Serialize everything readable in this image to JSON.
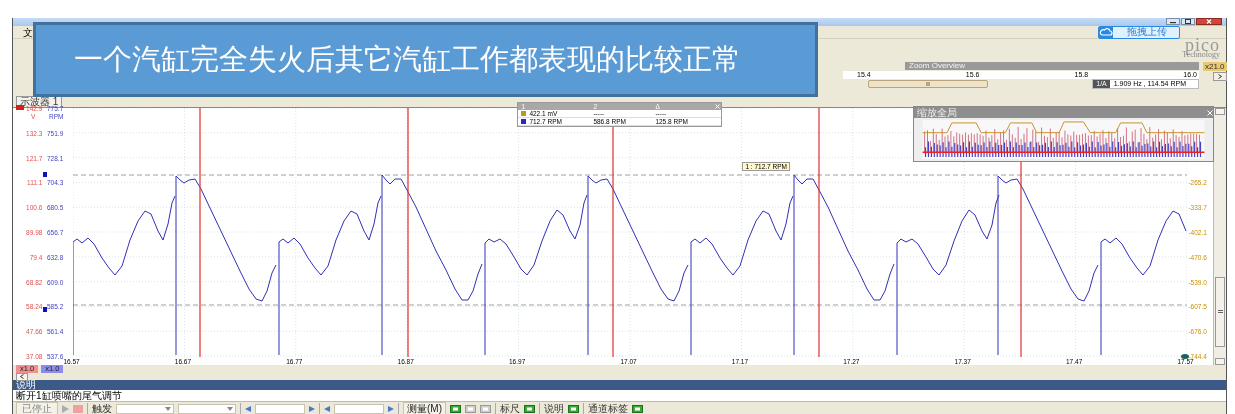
{
  "banner": {
    "text": "一个汽缸完全失火后其它汽缸工作都表现的比较正常"
  },
  "menu": {
    "items": [
      "文"
    ]
  },
  "upload_button": {
    "label": "拖拽上传"
  },
  "logo": {
    "text": "pico",
    "subtitle": "Technology"
  },
  "zoom_overview": {
    "title": "Zoom Overview",
    "ticks": [
      "15.4",
      "15.6",
      "15.8",
      "16.0"
    ],
    "readout_channel": "1/A",
    "readout": "1.909 Hz , 114.54 RPM",
    "zoom_badge": "x21.0"
  },
  "scope": {
    "tab": "示波器 1",
    "left_axis": {
      "unit": "V",
      "ticks": [
        "142.9",
        "132.3",
        "121.7",
        "111.1",
        "100.6",
        "89.98",
        "79.4",
        "68.82",
        "58.24",
        "47.66",
        "37.08"
      ]
    },
    "rpm_axis": {
      "unit": "RPM",
      "ticks": [
        "775.7",
        "751.9",
        "728.1",
        "704.3",
        "680.5",
        "656.7",
        "632.8",
        "609.0",
        "585.2",
        "561.4",
        "537.6"
      ]
    },
    "right_axis": {
      "ticks": [
        "-265.2",
        "-333.7",
        "-402.1",
        "-470.6",
        "-539.0",
        "-607.5",
        "-676.0",
        "-744.4"
      ]
    },
    "x_ticks": [
      "16.57",
      "16.67",
      "16.77",
      "16.87",
      "16.97",
      "17.07",
      "17.17",
      "17.27",
      "17.37",
      "17.47",
      "17.57"
    ],
    "cursor_table": {
      "columns": [
        "1",
        "2",
        "Δ"
      ],
      "rows": [
        {
          "color": "#b89a20",
          "cells": [
            "422.1 mV",
            "-----",
            "-----"
          ]
        },
        {
          "color": "#2828c8",
          "cells": [
            "712.7 RPM",
            "586.8 RPM",
            "125.8 RPM"
          ]
        }
      ]
    },
    "cursor_tooltip": "1 : 712.7 RPM",
    "overview_window": {
      "title": "缩放全局"
    },
    "channel_scales": [
      {
        "label": "x1.0",
        "color": "#f09090"
      },
      {
        "label": "x1.0",
        "color": "#8c8cf0"
      }
    ]
  },
  "notes": {
    "title": "说明",
    "text": "断开1缸喷嘴的尾气调节"
  },
  "status_bar": {
    "state": "已停止",
    "trigger": "触发",
    "measure": "测量(M)",
    "toggles": [
      {
        "label": "标尺",
        "on": true
      },
      {
        "label": "说明",
        "on": true
      },
      {
        "label": "通道标签",
        "on": true
      }
    ]
  }
}
